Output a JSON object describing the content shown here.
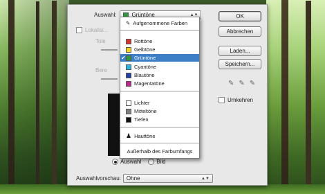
{
  "dialog": {
    "auswahl_label": "Auswahl:",
    "auswahl_value": "Grüntöne",
    "faded_checkbox": "Lokalisi...",
    "faded_label_1": "Tole",
    "faded_label_2": "Bere",
    "radio_auswahl": "Auswahl",
    "radio_bild": "Bild",
    "vorschau_label": "Auswahlvorschau:",
    "vorschau_value": "Ohne"
  },
  "buttons": {
    "ok": "OK",
    "cancel": "Abbrechen",
    "load": "Laden...",
    "save": "Speichern..."
  },
  "invert_label": "Umkehren",
  "dropdown": {
    "sampled": "Aufgenommene Farben",
    "colors": [
      {
        "label": "Rottöne",
        "color": "#d9312a"
      },
      {
        "label": "Gelbtöne",
        "color": "#f2d21b"
      },
      {
        "label": "Grüntöne",
        "color": "#2e9a3a"
      },
      {
        "label": "Cyantöne",
        "color": "#29b6e6"
      },
      {
        "label": "Blautöne",
        "color": "#1f3fa8"
      },
      {
        "label": "Magentatöne",
        "color": "#c0268e"
      }
    ],
    "tones": [
      {
        "label": "Lichter",
        "color": "#ffffff"
      },
      {
        "label": "Mitteltöne",
        "color": "#808080"
      },
      {
        "label": "Tiefen",
        "color": "#111111"
      }
    ],
    "skin": "Hauttöne",
    "out_of_gamut": "Außerhalb des Farbumfangs"
  }
}
